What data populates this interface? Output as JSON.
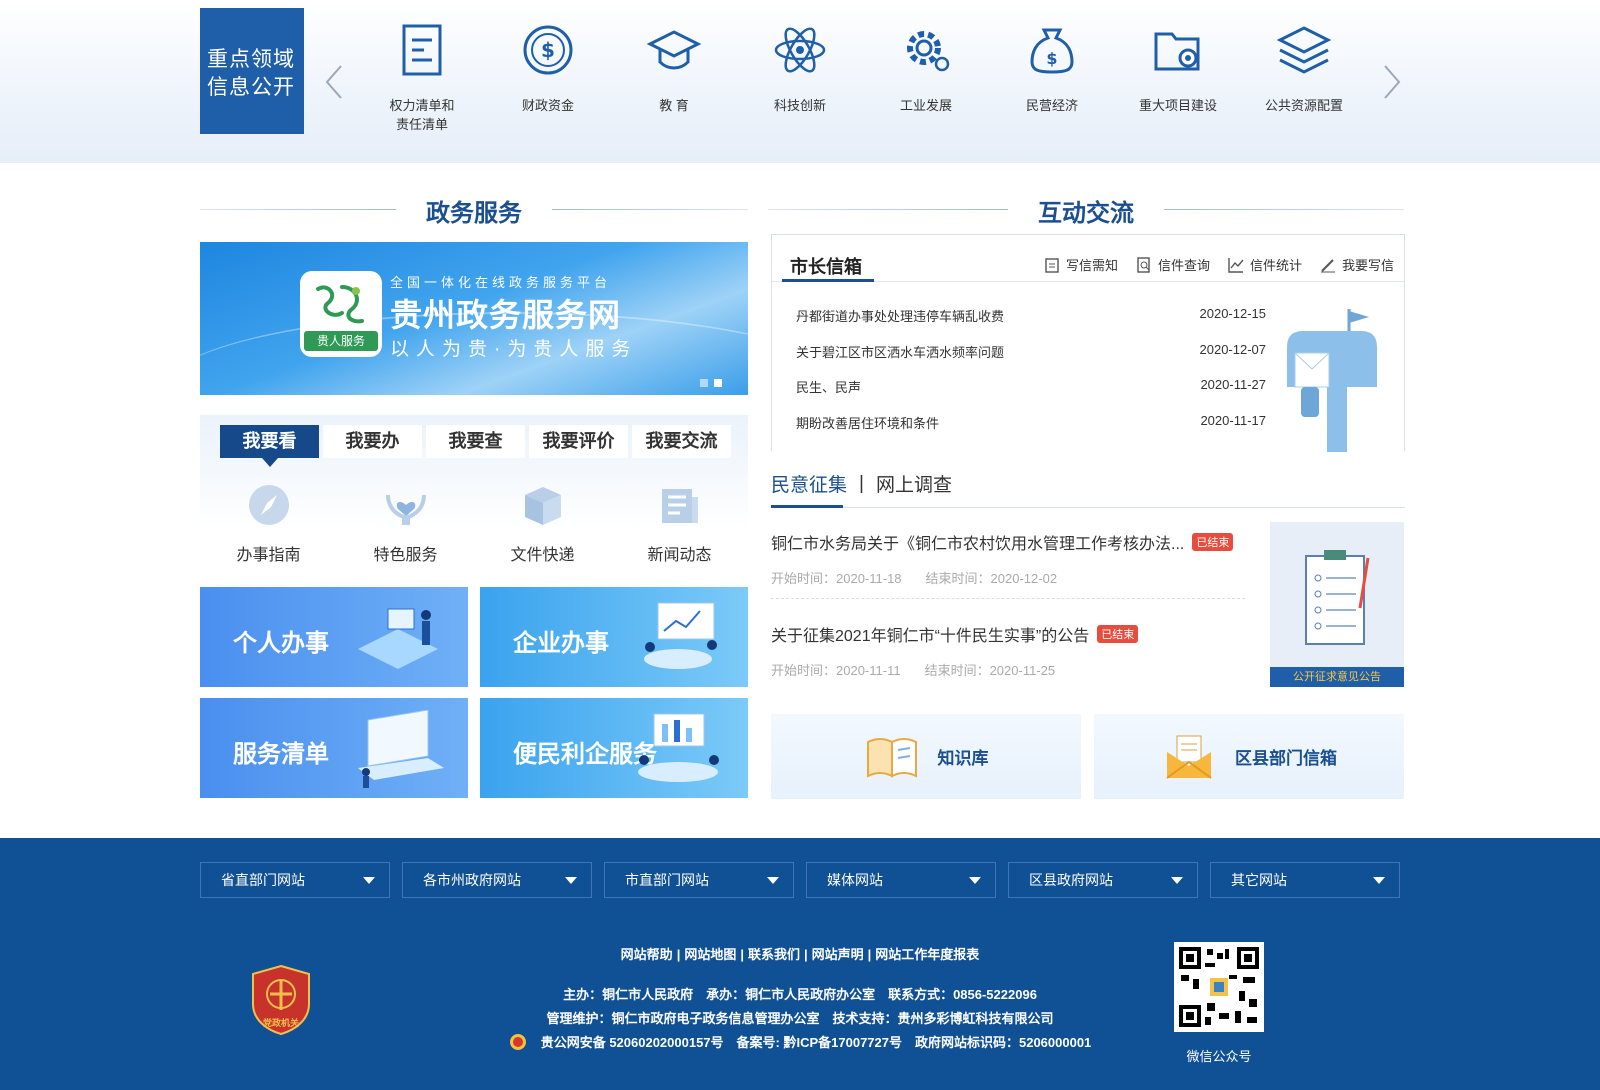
{
  "key_areas": {
    "box_title_line1": "重点领域",
    "box_title_line2": "信息公开",
    "items": [
      {
        "label": "权力清单和",
        "label2": "责任清单",
        "icon": "list-doc-icon"
      },
      {
        "label": "财政资金",
        "icon": "dollar-coin-icon"
      },
      {
        "label": "教 育",
        "icon": "graduation-cap-icon"
      },
      {
        "label": "科技创新",
        "icon": "atom-icon"
      },
      {
        "label": "工业发展",
        "icon": "gear-icon"
      },
      {
        "label": "民营经济",
        "icon": "money-bag-icon"
      },
      {
        "label": "重大项目建设",
        "icon": "folder-gear-icon"
      },
      {
        "label": "公共资源配置",
        "icon": "layers-icon"
      }
    ]
  },
  "gov_service": {
    "heading": "政务服务",
    "banner": {
      "subtitle_top": "全国一体化在线政务服务平台",
      "title": "贵州政务服务网",
      "subtitle_bottom": "以人为贵·为贵人服务",
      "logo_tag": "贵人服务"
    },
    "tabs": [
      "我要看",
      "我要办",
      "我要查",
      "我要评价",
      "我要交流"
    ],
    "tab_items": [
      {
        "label": "办事指南",
        "icon": "compass-icon"
      },
      {
        "label": "特色服务",
        "icon": "heart-hands-icon"
      },
      {
        "label": "文件快递",
        "icon": "box-icon"
      },
      {
        "label": "新闻动态",
        "icon": "news-icon"
      }
    ],
    "tiles": [
      "个人办事",
      "企业办事",
      "服务清单",
      "便民利企服务"
    ]
  },
  "interaction": {
    "heading": "互动交流",
    "mailbox": {
      "title": "市长信箱",
      "buttons": [
        "写信需知",
        "信件查询",
        "信件统计",
        "我要写信"
      ],
      "rows": [
        {
          "title": "丹都街道办事处处理违停车辆乱收费",
          "date": "2020-12-15"
        },
        {
          "title": "关于碧江区市区洒水车洒水频率问题",
          "date": "2020-12-07"
        },
        {
          "title": "民生、民声",
          "date": "2020-11-27"
        },
        {
          "title": "期盼改善居住环境和条件",
          "date": "2020-11-17"
        }
      ]
    },
    "opinion": {
      "tab_active": "民意征集",
      "tab_sep": "|",
      "tab_other": "网上调查",
      "items": [
        {
          "title": "铜仁市水务局关于《铜仁市农村饮用水管理工作考核办法...",
          "badge": "已结束",
          "start": "开始时间：2020-11-18",
          "end": "结束时间：2020-12-02"
        },
        {
          "title": "关于征集2021年铜仁市“十件民生实事”的公告",
          "badge": "已结束",
          "start": "开始时间：2020-11-11",
          "end": "结束时间：2020-11-25"
        }
      ],
      "card_label": "公开征求意见公告"
    },
    "shortcuts": [
      "知识库",
      "区县部门信箱"
    ]
  },
  "footer": {
    "dropdowns": [
      "省直部门网站",
      "各市州政府网站",
      "市直部门网站",
      "媒体网站",
      "区县政府网站",
      "其它网站"
    ],
    "links": [
      "网站帮助",
      "网站地图",
      "联系我们",
      "网站声明",
      "网站工作年度报表"
    ],
    "link_sep": "|",
    "info1": "主办：铜仁市人民政府　承办：铜仁市人民政府办公室　联系方式：0856-5222096",
    "info2": "管理维护：铜仁市政府电子政务信息管理办公室　技术支持：贵州多彩博虹科技有限公司",
    "info3": "贵公网安备 52060202000157号　备案号: 黔ICP备17007727号　政府网站标识码：5206000001",
    "emblem_text": "党政机关",
    "qr_label": "微信公众号"
  },
  "colors": {
    "primary": "#1f5fa9",
    "dark_blue": "#16498a",
    "footer": "#105094",
    "badge": "#e84c3d"
  }
}
